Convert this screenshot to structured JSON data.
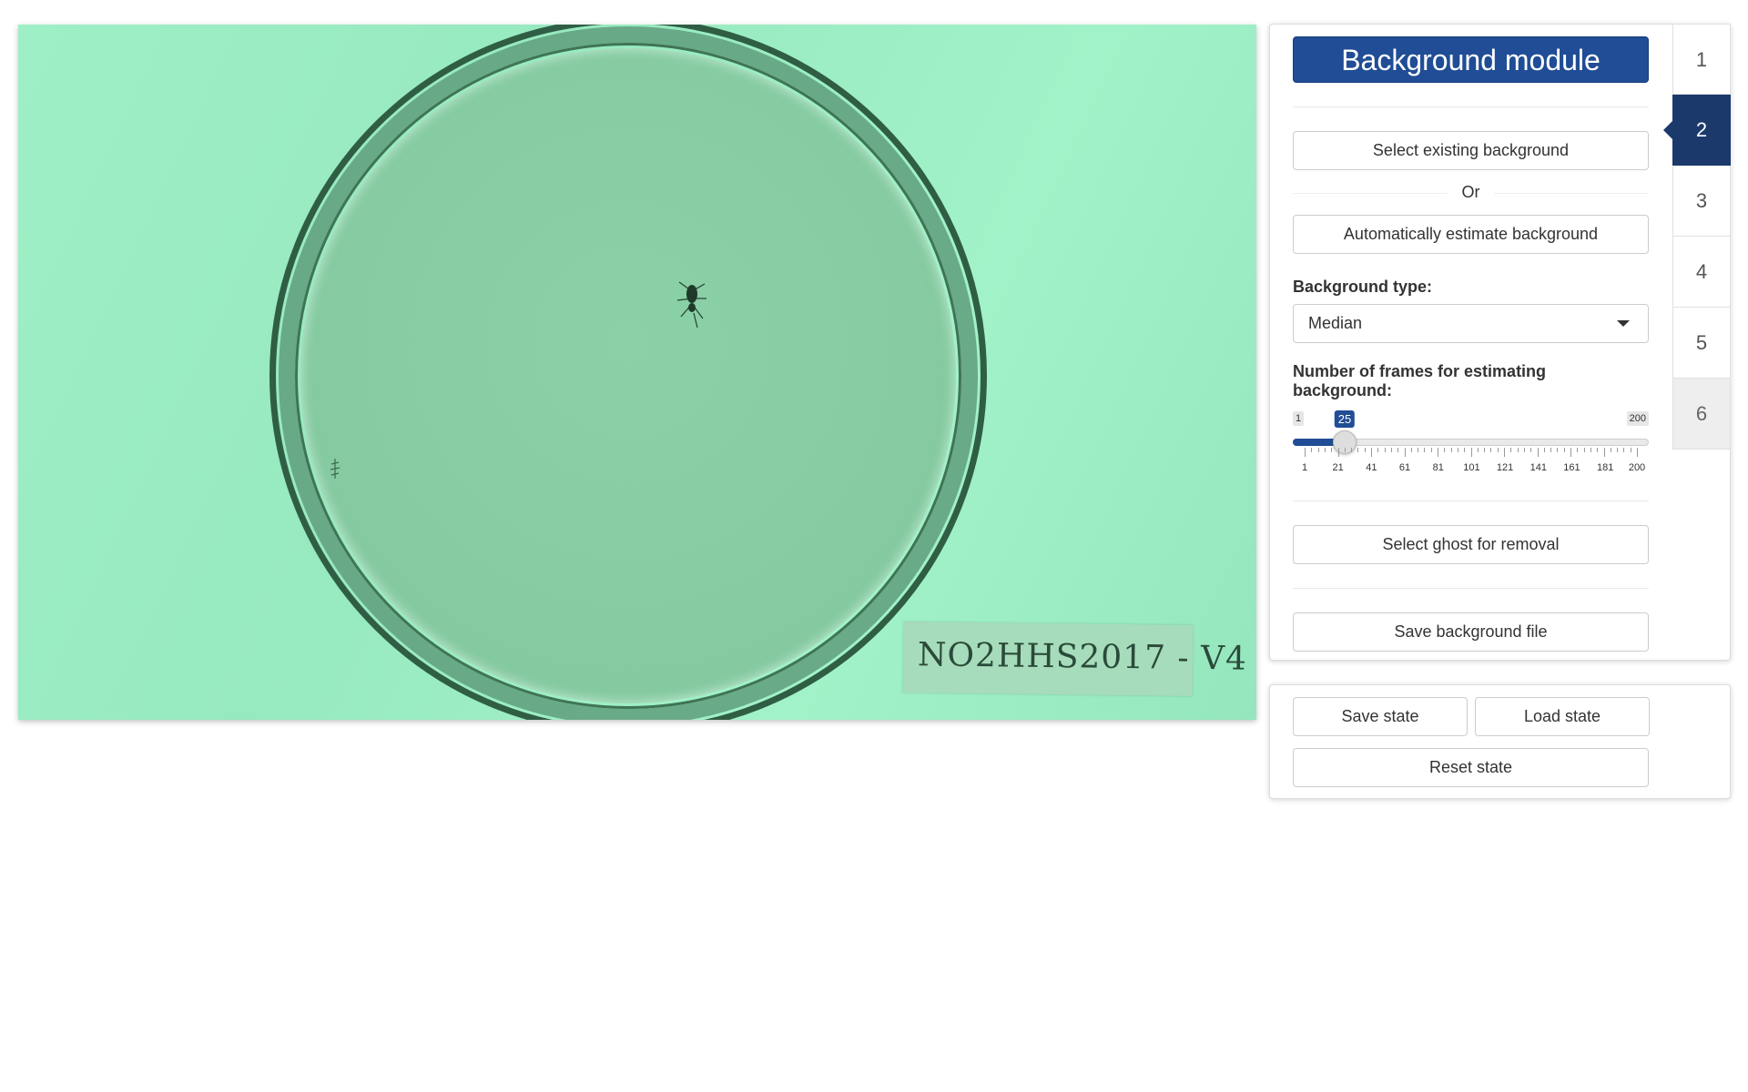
{
  "video": {
    "label_text": "NO2HHS2017 - V4"
  },
  "panel": {
    "title": "Background module",
    "select_existing_label": "Select existing background",
    "or_label": "Or",
    "auto_estimate_label": "Automatically estimate background",
    "background_type_label": "Background type:",
    "background_type_value": "Median",
    "frames_label": "Number of frames for estimating background:",
    "select_ghost_label": "Select ghost for removal",
    "save_background_label": "Save background file"
  },
  "slider": {
    "min": 1,
    "max": 200,
    "value": 25,
    "min_text": "1",
    "max_text": "200",
    "value_text": "25",
    "tick_labels": [
      "1",
      "21",
      "41",
      "61",
      "81",
      "101",
      "121",
      "141",
      "161",
      "181",
      "200"
    ],
    "accent_color": "#204d95"
  },
  "tabs": {
    "items": [
      {
        "label": "1",
        "state": "normal"
      },
      {
        "label": "2",
        "state": "active"
      },
      {
        "label": "3",
        "state": "normal"
      },
      {
        "label": "4",
        "state": "normal"
      },
      {
        "label": "5",
        "state": "normal"
      },
      {
        "label": "6",
        "state": "disabled"
      }
    ],
    "active_color": "#1b3a6b"
  },
  "state_panel": {
    "save_label": "Save state",
    "load_label": "Load state",
    "reset_label": "Reset state"
  }
}
